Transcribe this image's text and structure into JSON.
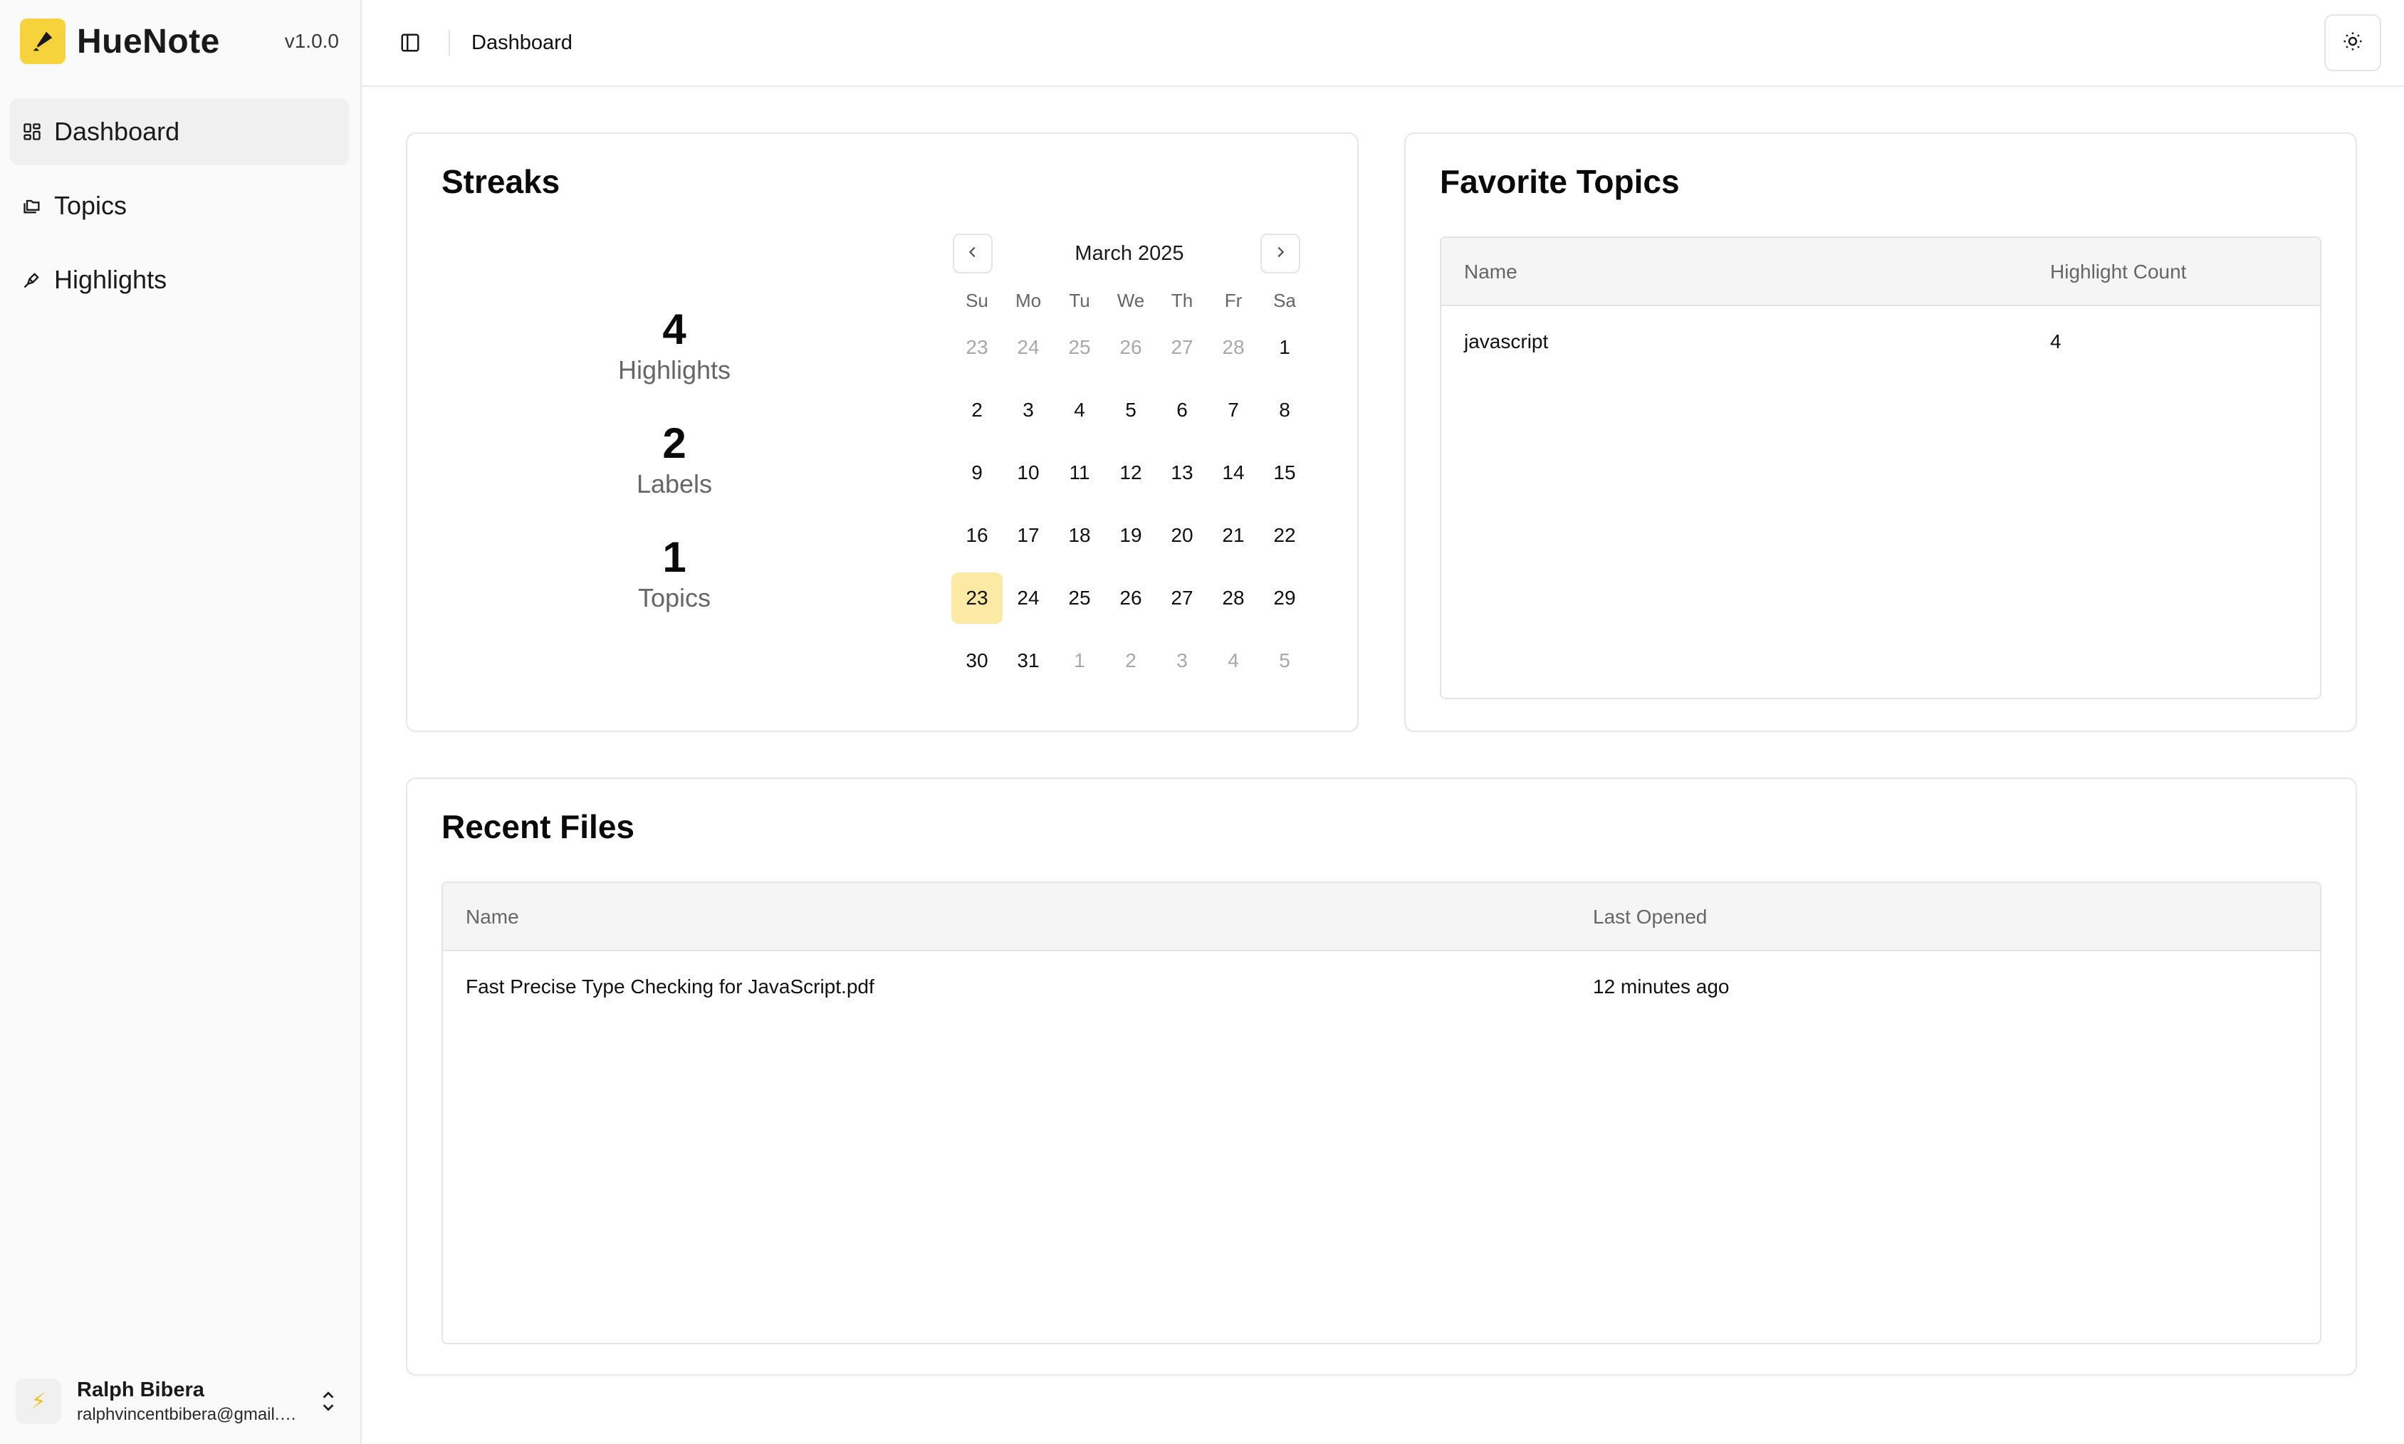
{
  "app": {
    "name": "HueNote",
    "version": "v1.0.0",
    "accent": "#f6d33c"
  },
  "sidebar": {
    "items": [
      {
        "label": "Dashboard",
        "icon": "dashboard-grid-icon",
        "active": true
      },
      {
        "label": "Topics",
        "icon": "folders-icon",
        "active": false
      },
      {
        "label": "Highlights",
        "icon": "highlighter-icon",
        "active": false
      }
    ],
    "user": {
      "name": "Ralph Bibera",
      "email": "ralphvincentbibera@gmail.com",
      "avatar_icon": "bolt-icon"
    }
  },
  "topbar": {
    "breadcrumb": "Dashboard",
    "toggle_icon": "sidebar-toggle-icon",
    "theme_icon": "sun-icon"
  },
  "streaks": {
    "title": "Streaks",
    "stats": [
      {
        "value": "4",
        "label": "Highlights"
      },
      {
        "value": "2",
        "label": "Labels"
      },
      {
        "value": "1",
        "label": "Topics"
      }
    ],
    "calendar": {
      "month": "March 2025",
      "weekdays": [
        "Su",
        "Mo",
        "Tu",
        "We",
        "Th",
        "Fr",
        "Sa"
      ],
      "weeks": [
        [
          "23",
          "24",
          "25",
          "26",
          "27",
          "28",
          "1"
        ],
        [
          "2",
          "3",
          "4",
          "5",
          "6",
          "7",
          "8"
        ],
        [
          "9",
          "10",
          "11",
          "12",
          "13",
          "14",
          "15"
        ],
        [
          "16",
          "17",
          "18",
          "19",
          "20",
          "21",
          "22"
        ],
        [
          "23",
          "24",
          "25",
          "26",
          "27",
          "28",
          "29"
        ],
        [
          "30",
          "31",
          "1",
          "2",
          "3",
          "4",
          "5"
        ]
      ],
      "today": "23",
      "today_color": "#fbe9a4"
    }
  },
  "favorite_topics": {
    "title": "Favorite Topics",
    "columns": [
      "Name",
      "Highlight Count"
    ],
    "rows": [
      {
        "name": "javascript",
        "count": "4"
      }
    ]
  },
  "recent_files": {
    "title": "Recent Files",
    "columns": [
      "Name",
      "Last Opened"
    ],
    "rows": [
      {
        "name": "Fast Precise Type Checking for JavaScript.pdf",
        "last_opened": "12 minutes ago"
      }
    ]
  }
}
